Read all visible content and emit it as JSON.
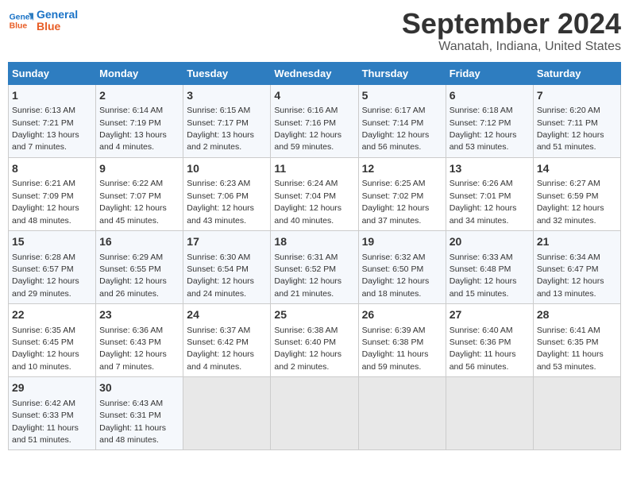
{
  "logo": {
    "line1": "General",
    "line2": "Blue"
  },
  "title": "September 2024",
  "subtitle": "Wanatah, Indiana, United States",
  "weekdays": [
    "Sunday",
    "Monday",
    "Tuesday",
    "Wednesday",
    "Thursday",
    "Friday",
    "Saturday"
  ],
  "weeks": [
    [
      {
        "day": "1",
        "info": "Sunrise: 6:13 AM\nSunset: 7:21 PM\nDaylight: 13 hours\nand 7 minutes."
      },
      {
        "day": "2",
        "info": "Sunrise: 6:14 AM\nSunset: 7:19 PM\nDaylight: 13 hours\nand 4 minutes."
      },
      {
        "day": "3",
        "info": "Sunrise: 6:15 AM\nSunset: 7:17 PM\nDaylight: 13 hours\nand 2 minutes."
      },
      {
        "day": "4",
        "info": "Sunrise: 6:16 AM\nSunset: 7:16 PM\nDaylight: 12 hours\nand 59 minutes."
      },
      {
        "day": "5",
        "info": "Sunrise: 6:17 AM\nSunset: 7:14 PM\nDaylight: 12 hours\nand 56 minutes."
      },
      {
        "day": "6",
        "info": "Sunrise: 6:18 AM\nSunset: 7:12 PM\nDaylight: 12 hours\nand 53 minutes."
      },
      {
        "day": "7",
        "info": "Sunrise: 6:20 AM\nSunset: 7:11 PM\nDaylight: 12 hours\nand 51 minutes."
      }
    ],
    [
      {
        "day": "8",
        "info": "Sunrise: 6:21 AM\nSunset: 7:09 PM\nDaylight: 12 hours\nand 48 minutes."
      },
      {
        "day": "9",
        "info": "Sunrise: 6:22 AM\nSunset: 7:07 PM\nDaylight: 12 hours\nand 45 minutes."
      },
      {
        "day": "10",
        "info": "Sunrise: 6:23 AM\nSunset: 7:06 PM\nDaylight: 12 hours\nand 43 minutes."
      },
      {
        "day": "11",
        "info": "Sunrise: 6:24 AM\nSunset: 7:04 PM\nDaylight: 12 hours\nand 40 minutes."
      },
      {
        "day": "12",
        "info": "Sunrise: 6:25 AM\nSunset: 7:02 PM\nDaylight: 12 hours\nand 37 minutes."
      },
      {
        "day": "13",
        "info": "Sunrise: 6:26 AM\nSunset: 7:01 PM\nDaylight: 12 hours\nand 34 minutes."
      },
      {
        "day": "14",
        "info": "Sunrise: 6:27 AM\nSunset: 6:59 PM\nDaylight: 12 hours\nand 32 minutes."
      }
    ],
    [
      {
        "day": "15",
        "info": "Sunrise: 6:28 AM\nSunset: 6:57 PM\nDaylight: 12 hours\nand 29 minutes."
      },
      {
        "day": "16",
        "info": "Sunrise: 6:29 AM\nSunset: 6:55 PM\nDaylight: 12 hours\nand 26 minutes."
      },
      {
        "day": "17",
        "info": "Sunrise: 6:30 AM\nSunset: 6:54 PM\nDaylight: 12 hours\nand 24 minutes."
      },
      {
        "day": "18",
        "info": "Sunrise: 6:31 AM\nSunset: 6:52 PM\nDaylight: 12 hours\nand 21 minutes."
      },
      {
        "day": "19",
        "info": "Sunrise: 6:32 AM\nSunset: 6:50 PM\nDaylight: 12 hours\nand 18 minutes."
      },
      {
        "day": "20",
        "info": "Sunrise: 6:33 AM\nSunset: 6:48 PM\nDaylight: 12 hours\nand 15 minutes."
      },
      {
        "day": "21",
        "info": "Sunrise: 6:34 AM\nSunset: 6:47 PM\nDaylight: 12 hours\nand 13 minutes."
      }
    ],
    [
      {
        "day": "22",
        "info": "Sunrise: 6:35 AM\nSunset: 6:45 PM\nDaylight: 12 hours\nand 10 minutes."
      },
      {
        "day": "23",
        "info": "Sunrise: 6:36 AM\nSunset: 6:43 PM\nDaylight: 12 hours\nand 7 minutes."
      },
      {
        "day": "24",
        "info": "Sunrise: 6:37 AM\nSunset: 6:42 PM\nDaylight: 12 hours\nand 4 minutes."
      },
      {
        "day": "25",
        "info": "Sunrise: 6:38 AM\nSunset: 6:40 PM\nDaylight: 12 hours\nand 2 minutes."
      },
      {
        "day": "26",
        "info": "Sunrise: 6:39 AM\nSunset: 6:38 PM\nDaylight: 11 hours\nand 59 minutes."
      },
      {
        "day": "27",
        "info": "Sunrise: 6:40 AM\nSunset: 6:36 PM\nDaylight: 11 hours\nand 56 minutes."
      },
      {
        "day": "28",
        "info": "Sunrise: 6:41 AM\nSunset: 6:35 PM\nDaylight: 11 hours\nand 53 minutes."
      }
    ],
    [
      {
        "day": "29",
        "info": "Sunrise: 6:42 AM\nSunset: 6:33 PM\nDaylight: 11 hours\nand 51 minutes."
      },
      {
        "day": "30",
        "info": "Sunrise: 6:43 AM\nSunset: 6:31 PM\nDaylight: 11 hours\nand 48 minutes."
      },
      {
        "day": "",
        "info": ""
      },
      {
        "day": "",
        "info": ""
      },
      {
        "day": "",
        "info": ""
      },
      {
        "day": "",
        "info": ""
      },
      {
        "day": "",
        "info": ""
      }
    ]
  ]
}
